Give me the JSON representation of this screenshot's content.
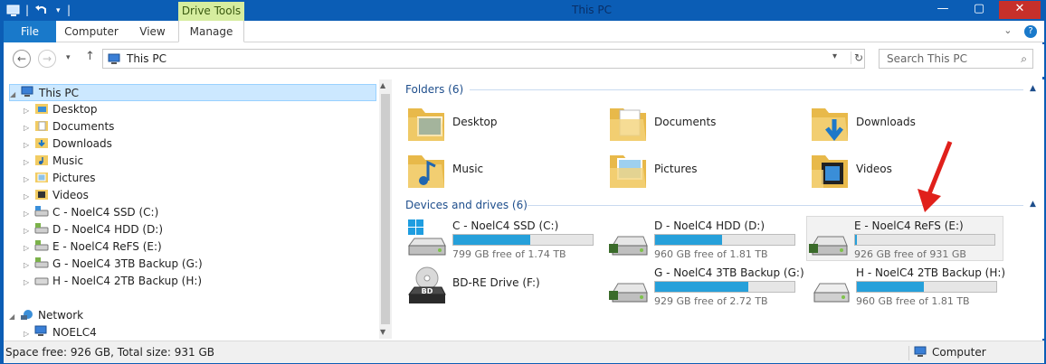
{
  "window": {
    "title": "This PC",
    "context_tab": "Drive Tools"
  },
  "ribbon": {
    "tabs": [
      "File",
      "Computer",
      "View",
      "Manage"
    ]
  },
  "address": {
    "path": "This PC",
    "search_placeholder": "Search This PC"
  },
  "tree": {
    "root": "This PC",
    "items": [
      {
        "label": "Desktop",
        "icon": "folder-desktop-icon"
      },
      {
        "label": "Documents",
        "icon": "folder-documents-icon"
      },
      {
        "label": "Downloads",
        "icon": "folder-downloads-icon"
      },
      {
        "label": "Music",
        "icon": "folder-music-icon"
      },
      {
        "label": "Pictures",
        "icon": "folder-pictures-icon"
      },
      {
        "label": "Videos",
        "icon": "folder-videos-icon"
      },
      {
        "label": "C - NoelC4 SSD (C:)",
        "icon": "drive-icon"
      },
      {
        "label": "D - NoelC4 HDD (D:)",
        "icon": "drive-icon"
      },
      {
        "label": "E - NoelC4 ReFS (E:)",
        "icon": "drive-icon"
      },
      {
        "label": "G - NoelC4 3TB Backup (G:)",
        "icon": "drive-icon"
      },
      {
        "label": "H - NoelC4 2TB Backup (H:)",
        "icon": "drive-icon"
      }
    ],
    "network": "Network",
    "network_items": [
      "NOELC4"
    ]
  },
  "content": {
    "folders_header": "Folders (6)",
    "folders": [
      "Desktop",
      "Documents",
      "Downloads",
      "Music",
      "Pictures",
      "Videos"
    ],
    "devices_header": "Devices and drives (6)",
    "drives": [
      {
        "name": "C - NoelC4 SSD (C:)",
        "free_text": "799 GB free of 1.74 TB",
        "used_fraction": 0.55
      },
      {
        "name": "D - NoelC4 HDD (D:)",
        "free_text": "960 GB free of 1.81 TB",
        "used_fraction": 0.48
      },
      {
        "name": "E - NoelC4 ReFS (E:)",
        "free_text": "926 GB free of 931 GB",
        "used_fraction": 0.01
      },
      {
        "name": "BD-RE Drive (F:)",
        "free_text": "",
        "used_fraction": null
      },
      {
        "name": "G - NoelC4 3TB Backup (G:)",
        "free_text": "929 GB free of 2.72 TB",
        "used_fraction": 0.67
      },
      {
        "name": "H - NoelC4 2TB Backup (H:)",
        "free_text": "960 GB free of 1.81 TB",
        "used_fraction": 0.48
      }
    ],
    "optical_badge": "BD"
  },
  "status": {
    "left": "Space free: 926 GB, Total size: 931 GB",
    "right": "Computer"
  },
  "colors": {
    "accent": "#0b5db5",
    "bar_fill": "#26a0da",
    "annotation": "#e0201b"
  }
}
